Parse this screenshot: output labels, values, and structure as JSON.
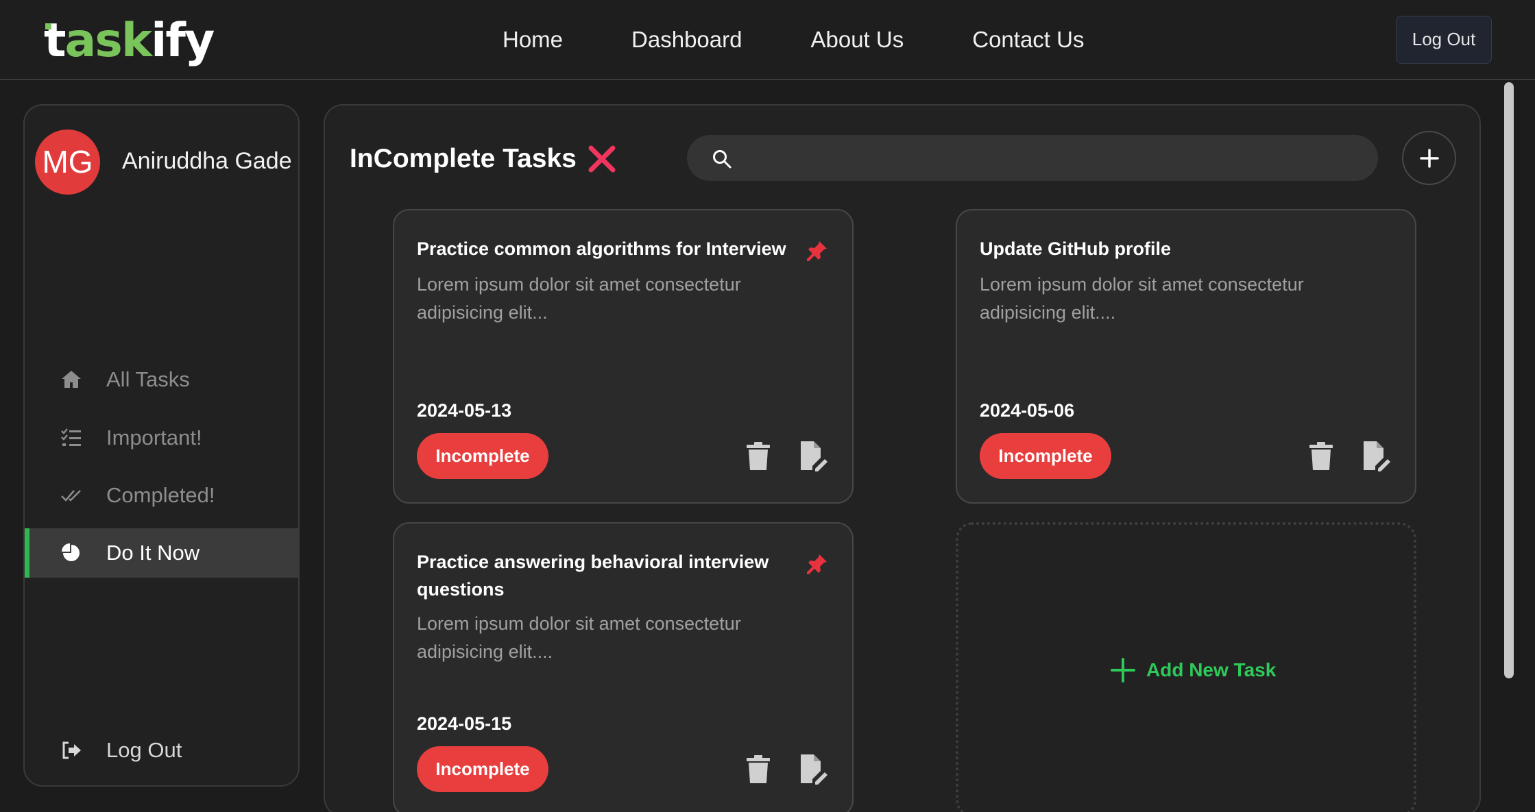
{
  "app": {
    "logo": {
      "t": "t",
      "ask": "ask",
      "ify": "ify"
    }
  },
  "nav": {
    "links": [
      "Home",
      "Dashboard",
      "About Us",
      "Contact Us"
    ],
    "logout_label": "Log Out"
  },
  "sidebar": {
    "avatar_initials": "MG",
    "username": "Aniruddha Gade",
    "items": [
      {
        "label": "All Tasks",
        "icon": "home-icon",
        "active": false
      },
      {
        "label": "Important!",
        "icon": "list-check-icon",
        "active": false
      },
      {
        "label": "Completed!",
        "icon": "double-check-icon",
        "active": false
      },
      {
        "label": "Do It Now",
        "icon": "pie-chart-icon",
        "active": true
      }
    ],
    "logout_label": "Log Out"
  },
  "main": {
    "title": "InComplete Tasks",
    "search": {
      "placeholder": ""
    },
    "tasks": [
      {
        "title": "Practice common algorithms for Interview",
        "description": "Lorem ipsum dolor sit amet consectetur adipisicing elit...",
        "date": "2024-05-13",
        "status": "Incomplete",
        "pinned": true
      },
      {
        "title": "Update GitHub profile",
        "description": "Lorem ipsum dolor sit amet consectetur adipisicing elit....",
        "date": "2024-05-06",
        "status": "Incomplete",
        "pinned": false
      },
      {
        "title": "Practice answering behavioral interview questions",
        "description": "Lorem ipsum dolor sit amet consectetur adipisicing elit....",
        "date": "2024-05-15",
        "status": "Incomplete",
        "pinned": true
      }
    ],
    "add_task_label": "Add New Task"
  },
  "colors": {
    "accent_green": "#2fc95a",
    "status_red": "#e83e3e",
    "avatar_red": "#e23b3b",
    "title_x_pink": "#f0365f"
  }
}
